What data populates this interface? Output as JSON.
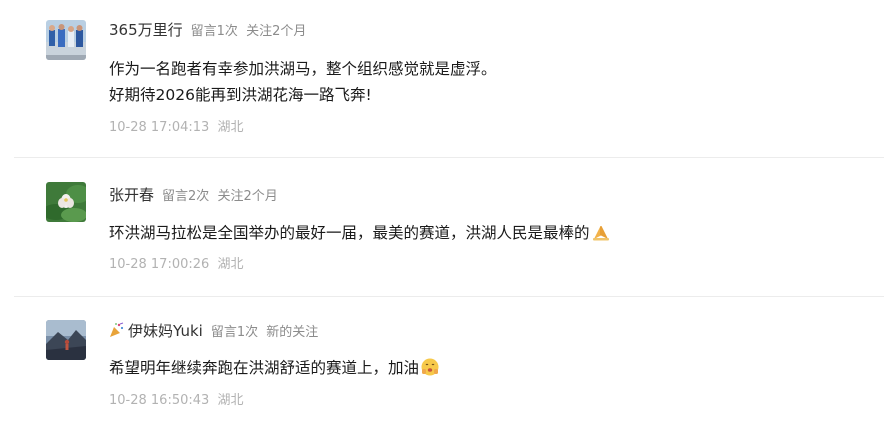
{
  "comments": [
    {
      "nickname": "365万里行",
      "stats": {
        "messages": "留言1次",
        "follow": "关注2个月"
      },
      "lines": [
        "作为一名跑者有幸参加洪湖马，整个组织感觉就是虚浮。",
        "好期待2026能再到洪湖花海一路飞奔!"
      ],
      "time": "10-28 17:04:13",
      "location": "湖北",
      "avatar_icon": "runners-photo-icon"
    },
    {
      "nickname": "张开春",
      "stats": {
        "messages": "留言2次",
        "follow": "关注2个月"
      },
      "lines": [
        "环洪湖马拉松是全国举办的最好一届，最美的赛道，洪湖人民是最棒的"
      ],
      "trailing_emoji": "praying-hands-emoji-icon",
      "time": "10-28 17:00:26",
      "location": "湖北",
      "avatar_icon": "lotus-photo-icon"
    },
    {
      "nickname": "伊妹妈Yuki",
      "nickname_prefix_icon": "party-popper-icon",
      "stats": {
        "messages": "留言1次",
        "follow": "新的关注"
      },
      "lines": [
        "希望明年继续奔跑在洪湖舒适的赛道上，加油"
      ],
      "trailing_emoji": "cheering-face-emoji-icon",
      "time": "10-28 16:50:43",
      "location": "湖北",
      "avatar_icon": "landscape-photo-icon"
    }
  ],
  "colors": {
    "nickname": "#333333",
    "meta": "#8c8c8c",
    "body": "#1a1a1a",
    "time": "#b2b2b2",
    "divider": "#ececec"
  }
}
